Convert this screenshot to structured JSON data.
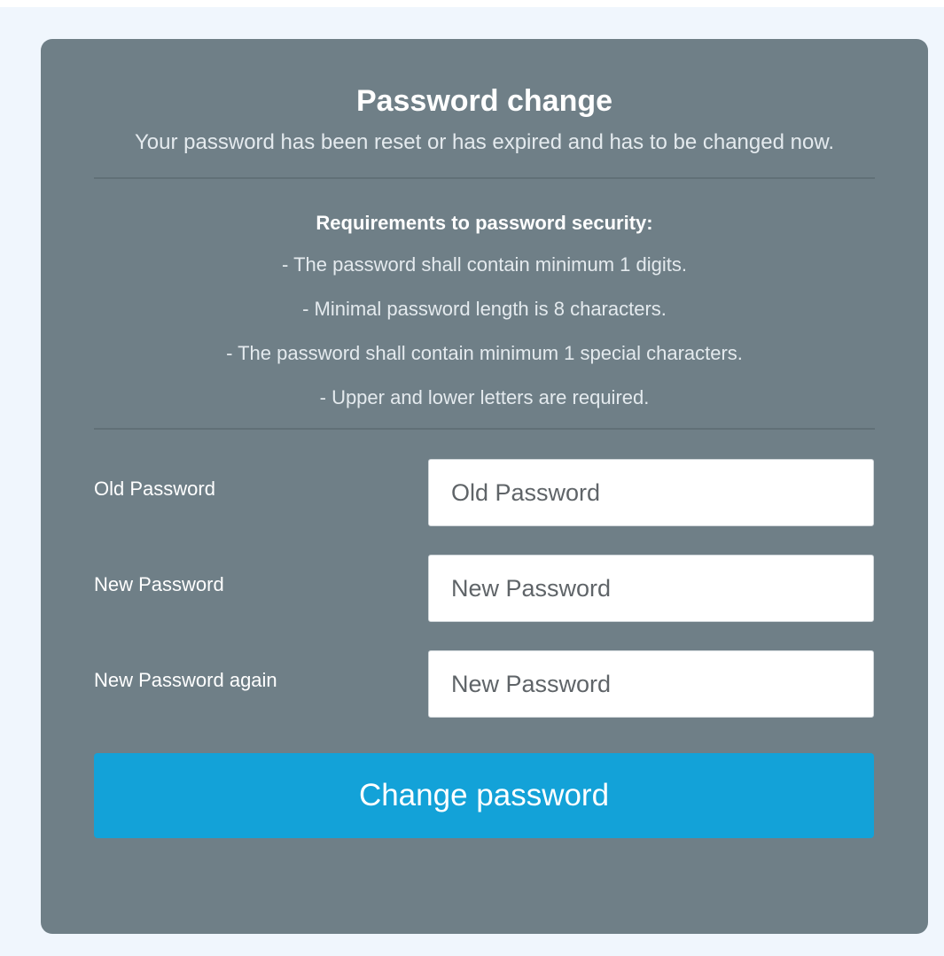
{
  "form": {
    "title": "Password change",
    "subtitle": "Your password has been reset or has expired and has to be changed now.",
    "requirements": {
      "heading": "Requirements to password security:",
      "items": [
        "- The password shall contain minimum 1 digits.",
        "- Minimal password length is 8 characters.",
        "- The password shall contain minimum 1 special characters.",
        "- Upper and lower letters are required."
      ]
    },
    "fields": [
      {
        "label": "Old Password",
        "placeholder": "Old Password",
        "value": ""
      },
      {
        "label": "New Password",
        "placeholder": "New Password",
        "value": ""
      },
      {
        "label": "New Password again",
        "placeholder": "New Password",
        "value": ""
      }
    ],
    "submit_label": "Change password"
  },
  "colors": {
    "page_background": "#f0f6fd",
    "card_background": "#6f7f87",
    "button_background": "#13a2d8",
    "text_primary": "#ffffff"
  }
}
